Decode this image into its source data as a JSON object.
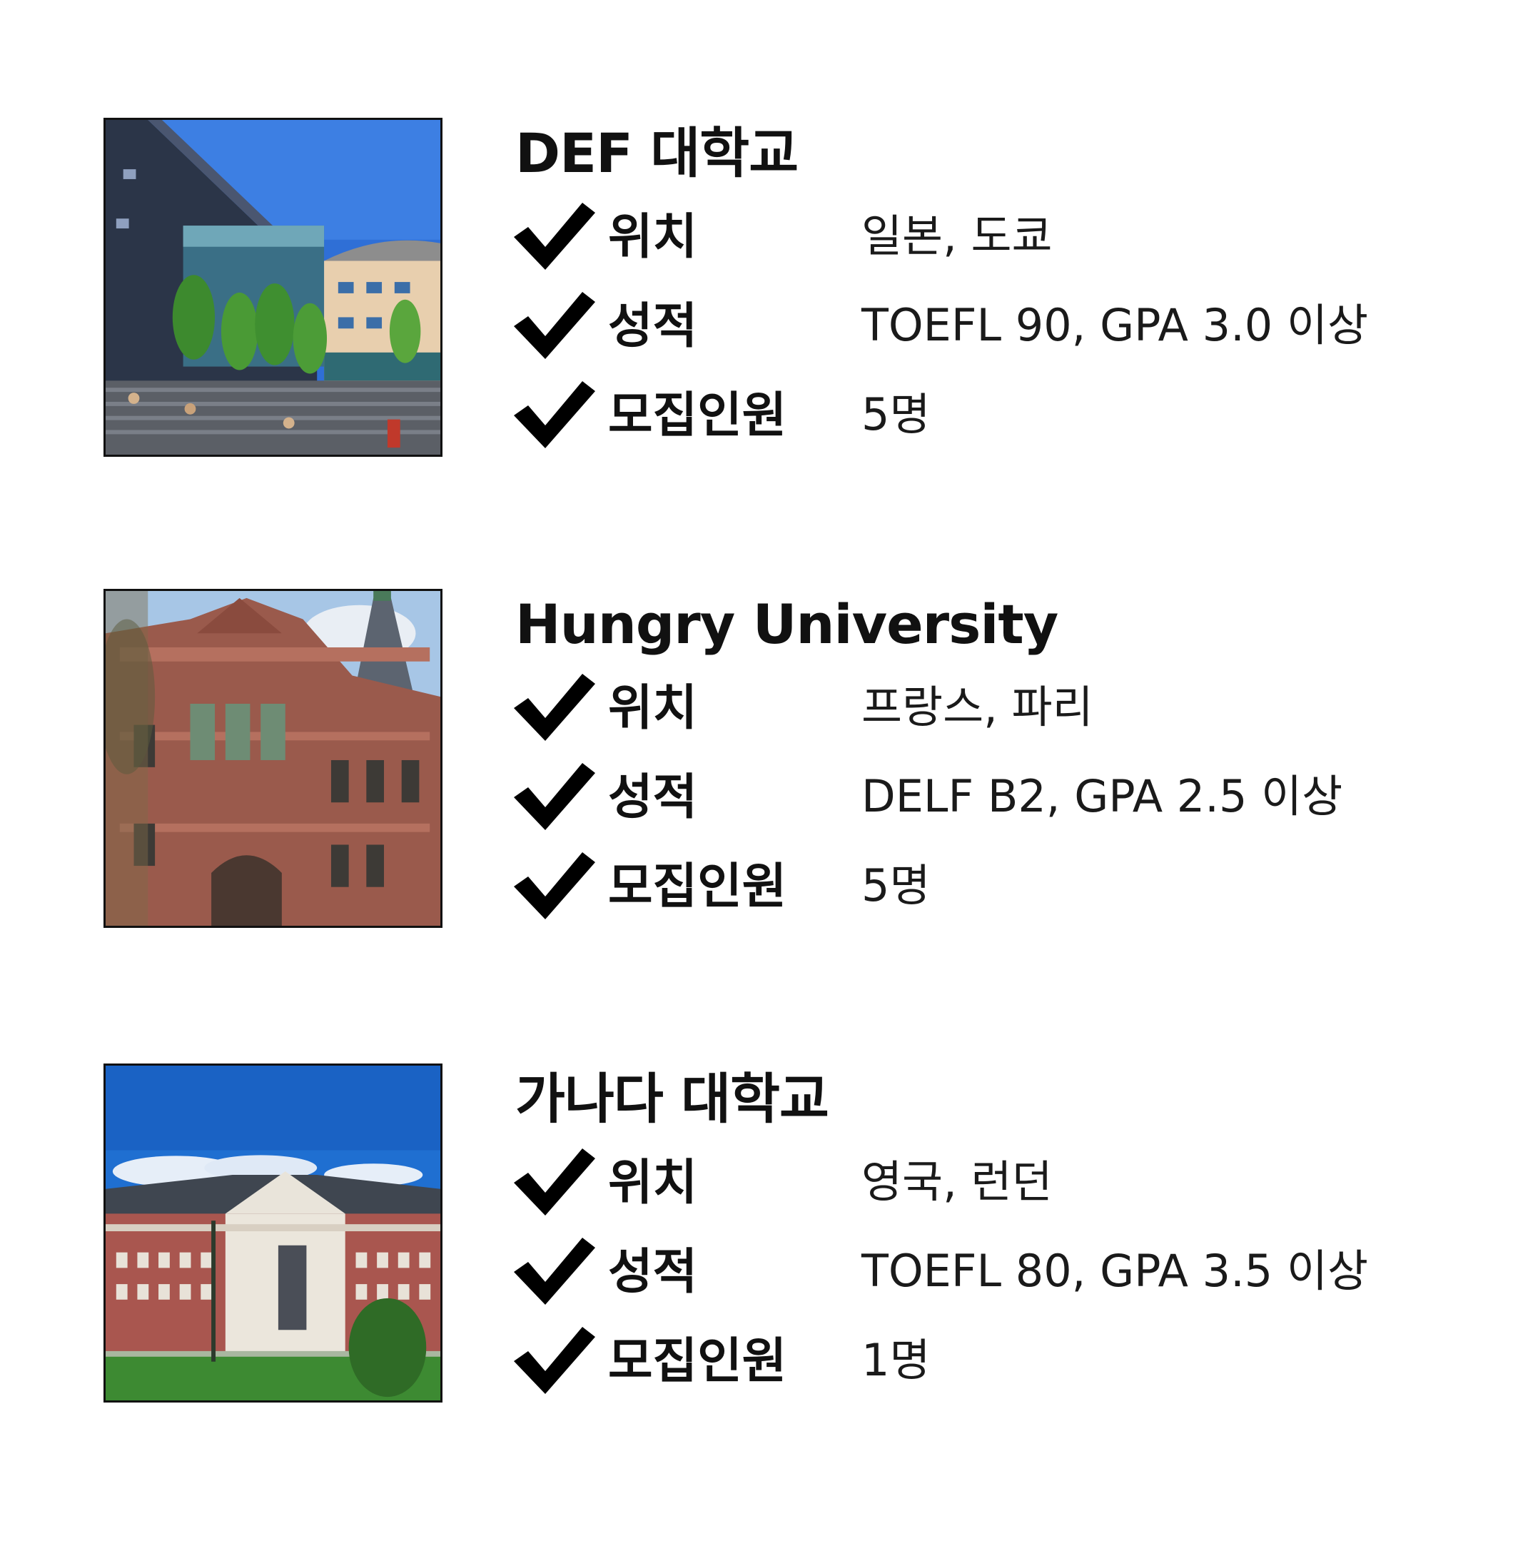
{
  "universities": [
    {
      "name": "DEF 대학교",
      "photo": "modern-campus-building-photo",
      "rows": [
        {
          "label": "위치",
          "value": "일본, 도쿄"
        },
        {
          "label": "성적",
          "value": "TOEFL 90, GPA 3.0 이상"
        },
        {
          "label": "모집인원",
          "value": "5명"
        }
      ]
    },
    {
      "name": "Hungry University",
      "photo": "historic-red-sandstone-building-photo",
      "rows": [
        {
          "label": "위치",
          "value": "프랑스, 파리"
        },
        {
          "label": "성적",
          "value": "DELF B2, GPA 2.5 이상"
        },
        {
          "label": "모집인원",
          "value": "5명"
        }
      ]
    },
    {
      "name": "가나다 대학교",
      "photo": "brick-college-hall-photo",
      "rows": [
        {
          "label": "위치",
          "value": "영국, 런던"
        },
        {
          "label": "성적",
          "value": "TOEFL 80, GPA 3.5 이상"
        },
        {
          "label": "모집인원",
          "value": "1명"
        }
      ]
    }
  ],
  "icons": {
    "check": "checkmark-icon"
  }
}
